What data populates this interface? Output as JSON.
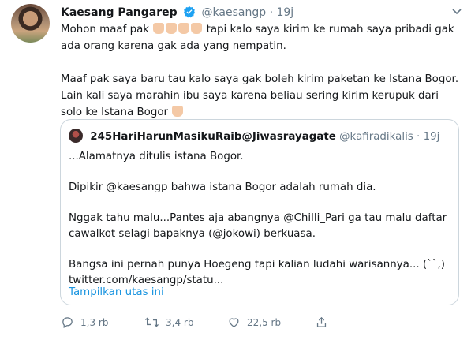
{
  "author": {
    "name": "Kaesang Pangarep",
    "handle": "@kaesangp",
    "separator": "·",
    "time": "19j"
  },
  "tweet": {
    "line1_before_emoji": "Mohon maaf pak",
    "line1_after_emoji": "tapi kalo saya kirim ke rumah saya pribadi gak ada orang karena gak ada yang nempatin.",
    "paragraph2": "Maaf pak saya baru tau kalo saya gak boleh kirim paketan ke Istana Bogor. Lain kali saya marahin ibu saya karena beliau sering kirim kerupuk dari solo ke Istana Bogor"
  },
  "quote": {
    "name": "245HariHarunMasikuRaib@Jiwasrayagate",
    "handle": "@kafiradikalis",
    "separator": "·",
    "time": "19j",
    "lines": [
      "...Alamatnya ditulis istana Bogor.",
      "Dipikir @kaesangp bahwa istana Bogor adalah rumah dia.",
      "Nggak tahu malu...Pantes aja abangnya @Chilli_Pari ga tau malu daftar cawalkot selagi bapaknya (@jokowi) berkuasa.",
      "Bangsa ini pernah punya Hoegeng tapi kalian ludahi warisannya... (``,)",
      "twitter.com/kaesangp/statu..."
    ],
    "show_thread": "Tampilkan utas ini"
  },
  "actions": {
    "replies": "1,3 rb",
    "retweets": "3,4 rb",
    "likes": "22,5 rb"
  },
  "colors": {
    "link": "#1b95e0",
    "muted": "#657786",
    "verified": "#1da1f2",
    "border": "#ccd6dd"
  }
}
